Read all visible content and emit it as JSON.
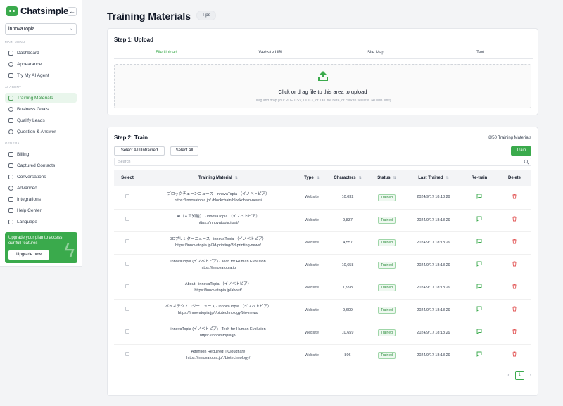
{
  "brand": {
    "name": "Chatsimple"
  },
  "workspace": {
    "name": "innovaTopia"
  },
  "sidebar": {
    "main_menu_label": "MAIN MENU",
    "main_items": [
      {
        "label": "Dashboard",
        "icon": "dashboard-icon"
      },
      {
        "label": "Appearance",
        "icon": "eye-icon"
      },
      {
        "label": "Try My AI Agent",
        "icon": "chat-icon"
      }
    ],
    "ai_agent_label": "AI AGENT",
    "ai_items": [
      {
        "label": "Training Materials",
        "icon": "document-icon",
        "active": true
      },
      {
        "label": "Business Goals",
        "icon": "target-icon"
      },
      {
        "label": "Qualify Leads",
        "icon": "funnel-icon"
      },
      {
        "label": "Question & Answer",
        "icon": "question-icon"
      }
    ],
    "general_label": "GENERAL",
    "general_items": [
      {
        "label": "Billing",
        "icon": "bolt-icon"
      },
      {
        "label": "Captured Contacts",
        "icon": "contacts-icon"
      },
      {
        "label": "Conversations",
        "icon": "conversation-icon"
      },
      {
        "label": "Advanced",
        "icon": "gear-icon"
      },
      {
        "label": "Integrations",
        "icon": "integrations-icon"
      },
      {
        "label": "Help Center",
        "icon": "help-icon"
      },
      {
        "label": "Language",
        "icon": "language-icon"
      }
    ],
    "upgrade": {
      "text": "Upgrade your plan to access our full features",
      "button": "Upgrade now"
    }
  },
  "header": {
    "title": "Training Materials",
    "tips_label": "Tips"
  },
  "upload": {
    "title": "Step 1: Upload",
    "tabs": [
      "File Upload",
      "Website URL",
      "Site Map",
      "Text"
    ],
    "active_tab": 0,
    "drop_main": "Click or drag file to this area to upload",
    "drop_sub": "Drag and drop your PDF, CSV, DOCX, or TXT file here, or click to select it. (40 MB limit)"
  },
  "train": {
    "title": "Step 2: Train",
    "count_text": "8/50 Training Materials",
    "select_all_untrained": "Select All Untrained",
    "select_all": "Select All",
    "train_label": "Train",
    "search_placeholder": "Search",
    "columns": [
      "Select",
      "Training Material",
      "Type",
      "Characters",
      "Status",
      "Last Trained",
      "Re-train",
      "Delete"
    ],
    "rows": [
      {
        "title": "ブロックチェーンニュース - innovaTopia （イノベトピア）",
        "url": "https://innovatopia.jp/./blockchain/blockchain-news/",
        "type": "Website",
        "chars": "10,032",
        "status": "Trained",
        "date": "2024/9/17 18:18:29"
      },
      {
        "title": "AI（人工知能） - innovaTopia （イノベトピア）",
        "url": "https://innovatopia.jp/ai/",
        "type": "Website",
        "chars": "9,837",
        "status": "Trained",
        "date": "2024/9/17 18:18:29"
      },
      {
        "title": "3Dプリンターニュース - innovaTopia （イノベトピア）",
        "url": "https://innovatopia.jp/3d-printing/3d-printing-news/",
        "type": "Website",
        "chars": "4,557",
        "status": "Trained",
        "date": "2024/9/17 18:18:29"
      },
      {
        "title": "innovaTopia (イノベトピア) - Tech for Human Evolution",
        "url": "https://innovatopia.jp",
        "type": "Website",
        "chars": "10,658",
        "status": "Trained",
        "date": "2024/9/17 18:18:29"
      },
      {
        "title": "About - innovaTopia （イノベトピア）",
        "url": "https://innovatopia.jp/about/",
        "type": "Website",
        "chars": "1,998",
        "status": "Trained",
        "date": "2024/9/17 18:18:29"
      },
      {
        "title": "バイオテクノロジーニュース - innovaTopia （イノベトピア）",
        "url": "https://innovatopia.jp/./biotechnology/bio-news/",
        "type": "Website",
        "chars": "9,609",
        "status": "Trained",
        "date": "2024/9/17 18:18:29"
      },
      {
        "title": "innovaTopia (イノベトピア) - Tech for Human Evolution",
        "url": "https://innovatopia.jp/",
        "type": "Website",
        "chars": "10,659",
        "status": "Trained",
        "date": "2024/9/17 18:18:29"
      },
      {
        "title": "Attention Required! | Cloudflare",
        "url": "https://innovatopia.jp/./biotechnology/",
        "type": "Website",
        "chars": "806",
        "status": "Trained",
        "date": "2024/9/17 18:18:29"
      }
    ],
    "page": "1"
  },
  "colors": {
    "accent": "#3aaa4c",
    "delete": "#e25555"
  }
}
